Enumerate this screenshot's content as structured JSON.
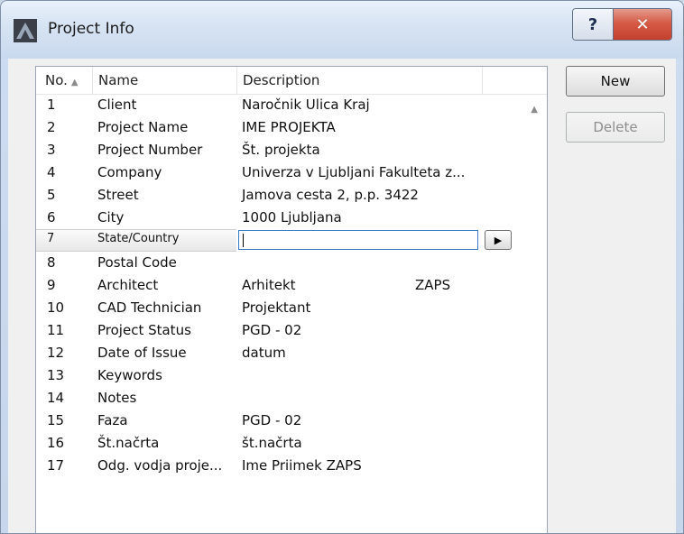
{
  "window": {
    "title": "Project Info",
    "help_label": "?",
    "close_label": "✕"
  },
  "list": {
    "headers": {
      "no": "No.",
      "name": "Name",
      "description": "Description"
    },
    "rows": [
      {
        "no": "1",
        "name": "Client",
        "description": "Naročnik Ulica Kraj",
        "extra": ""
      },
      {
        "no": "2",
        "name": "Project Name",
        "description": "IME PROJEKTA",
        "extra": ""
      },
      {
        "no": "3",
        "name": "Project Number",
        "description": "Št. projekta",
        "extra": ""
      },
      {
        "no": "4",
        "name": "Company",
        "description": "Univerza v Ljubljani Fakulteta z...",
        "extra": ""
      },
      {
        "no": "5",
        "name": "Street",
        "description": "Jamova cesta 2, p.p. 3422",
        "extra": ""
      },
      {
        "no": "6",
        "name": "City",
        "description": "1000 Ljubljana",
        "extra": ""
      },
      {
        "no": "7",
        "name": "State/Country",
        "description": "",
        "extra": ""
      },
      {
        "no": "8",
        "name": "Postal Code",
        "description": "",
        "extra": ""
      },
      {
        "no": "9",
        "name": "Architect",
        "description": "Arhitekt",
        "extra": "ZAPS"
      },
      {
        "no": "10",
        "name": "CAD Technician",
        "description": "Projektant",
        "extra": ""
      },
      {
        "no": "11",
        "name": "Project Status",
        "description": "PGD - 02",
        "extra": ""
      },
      {
        "no": "12",
        "name": "Date of Issue",
        "description": "datum",
        "extra": ""
      },
      {
        "no": "13",
        "name": "Keywords",
        "description": "",
        "extra": ""
      },
      {
        "no": "14",
        "name": "Notes",
        "description": "",
        "extra": ""
      },
      {
        "no": "15",
        "name": "Faza",
        "description": "PGD - 02",
        "extra": ""
      },
      {
        "no": "16",
        "name": "Št.načrta",
        "description": "št.načrta",
        "extra": ""
      },
      {
        "no": "17",
        "name": "Odg. vodja proje...",
        "description": "Ime Priimek    ZAPS",
        "extra": ""
      }
    ]
  },
  "buttons": {
    "new": "New",
    "delete": "Delete"
  }
}
